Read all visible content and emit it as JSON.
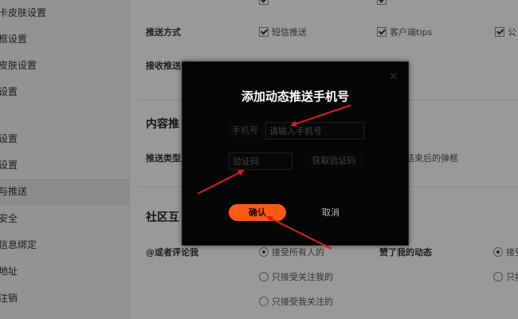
{
  "sidebar": {
    "items": [
      {
        "label": "卡皮肤设置"
      },
      {
        "label": "框设置"
      },
      {
        "label": "皮肤设置"
      },
      {
        "label": "设置"
      },
      {
        "label": "设置"
      },
      {
        "label": "设置"
      },
      {
        "label": "与推送"
      },
      {
        "label": "安全"
      },
      {
        "label": "信息绑定"
      },
      {
        "label": "地址"
      },
      {
        "label": "注销"
      }
    ]
  },
  "main": {
    "push_method": {
      "label": "推送方式",
      "options": [
        {
          "label": "短信推送",
          "checked": true
        },
        {
          "label": "客户端tips",
          "checked": true
        },
        {
          "label": "公",
          "checked": true
        }
      ]
    },
    "receive_phone": {
      "label": "接收推送手机号"
    },
    "content_section": {
      "title": "内容推"
    },
    "push_type": {
      "label": "推送类型",
      "trailing_text": "结束后的弹框"
    },
    "community_section": {
      "title": "社区互"
    },
    "mention_comment": {
      "label": "@或者评论我",
      "options": [
        {
          "label": "接受所有人的",
          "selected": true
        },
        {
          "label": "只接受关注我的",
          "selected": false
        },
        {
          "label": "只接受我关注的",
          "selected": false
        }
      ]
    },
    "liked_dynamic": {
      "label": "赞了我的动态",
      "options": [
        {
          "label": "接受",
          "selected": true
        },
        {
          "label": "只接",
          "selected": false
        }
      ]
    }
  },
  "dialog": {
    "title": "添加动态推送手机号",
    "close_glyph": "×",
    "phone_label": "手机号",
    "phone_placeholder": "请输入手机号",
    "code_placeholder": "验证码",
    "get_code_label": "获取验证码",
    "confirm_label": "确认",
    "cancel_label": "取消"
  },
  "colors": {
    "accent": "#ff5a14",
    "annotation_arrow": "#d42020",
    "dialog_bg": "#050505"
  }
}
